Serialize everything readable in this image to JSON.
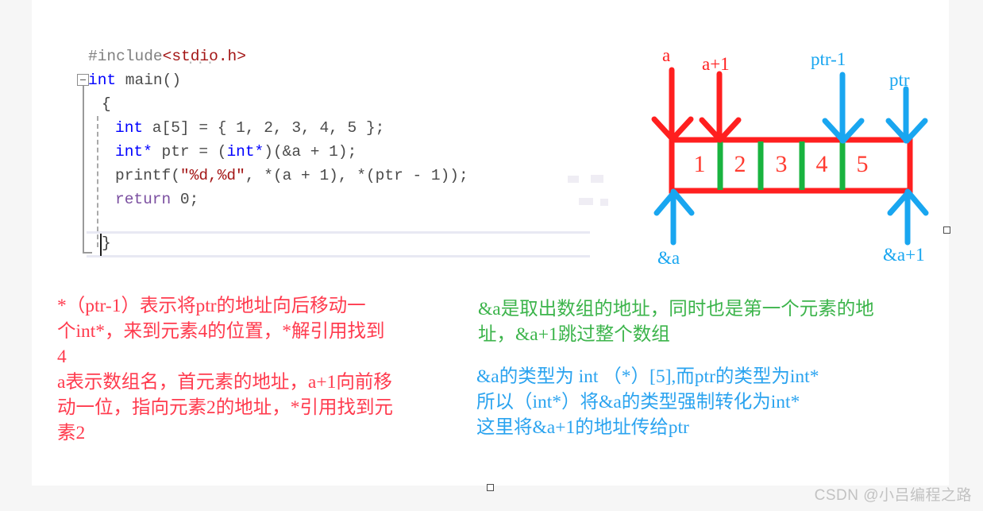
{
  "editor": {
    "fold_ellipsis": "...",
    "lines": [
      {
        "indent": 0,
        "tokens": [
          {
            "t": "#include",
            "c": "pp"
          },
          {
            "t": "<stdio.h>",
            "c": "str"
          }
        ]
      },
      {
        "indent": 0,
        "tokens": [
          {
            "t": "int",
            "c": "k"
          },
          {
            "t": " main()",
            "c": "id"
          }
        ]
      },
      {
        "indent": 1,
        "tokens": [
          {
            "t": "{",
            "c": "punct"
          }
        ]
      },
      {
        "indent": 2,
        "tokens": [
          {
            "t": "int",
            "c": "k"
          },
          {
            "t": " a[5] = { 1, 2, 3, 4, 5 };",
            "c": "id"
          }
        ]
      },
      {
        "indent": 2,
        "tokens": [
          {
            "t": "int*",
            "c": "k"
          },
          {
            "t": " ptr = (",
            "c": "id"
          },
          {
            "t": "int*",
            "c": "k"
          },
          {
            "t": ")(&a + 1);",
            "c": "id"
          }
        ]
      },
      {
        "indent": 2,
        "tokens": [
          {
            "t": "printf(",
            "c": "id"
          },
          {
            "t": "\"%d,%d\"",
            "c": "str"
          },
          {
            "t": ", *(a + 1), *(ptr - 1));",
            "c": "id"
          }
        ]
      },
      {
        "indent": 2,
        "tokens": [
          {
            "t": "return",
            "c": "pl"
          },
          {
            "t": " 0;",
            "c": "id"
          }
        ]
      },
      {
        "indent": 1,
        "tokens": [
          {
            "t": "}",
            "c": "punct"
          }
        ]
      }
    ]
  },
  "diagram": {
    "array_values": [
      "1",
      "2",
      "3",
      "4",
      "5"
    ],
    "box_color": "#ff1f1f",
    "divider_color": "#19b33f",
    "top_labels": [
      {
        "text": "a",
        "color": "red"
      },
      {
        "text": "a+1",
        "color": "red"
      },
      {
        "text": "ptr-1",
        "color": "blue"
      },
      {
        "text": "ptr",
        "color": "blue"
      }
    ],
    "bottom_labels": [
      {
        "text": "&a",
        "color": "blue"
      },
      {
        "text": "&a+1",
        "color": "blue"
      }
    ]
  },
  "notes": {
    "left_red": "*（ptr-1）表示将ptr的地址向后移动一\n个int*，来到元素4的位置，*解引用找到\n4\na表示数组名，首元素的地址，a+1向前移\n动一位，指向元素2的地址，*引用找到元\n素2",
    "right_green": "&a是取出数组的地址，同时也是第一个元素的地\n址，&a+1跳过整个数组",
    "right_blue": "&a的类型为 int （*）[5],而ptr的类型为int*\n所以（int*）将&a的类型强制转化为int*\n这里将&a+1的地址传给ptr"
  },
  "watermark": "CSDN @小吕编程之路"
}
